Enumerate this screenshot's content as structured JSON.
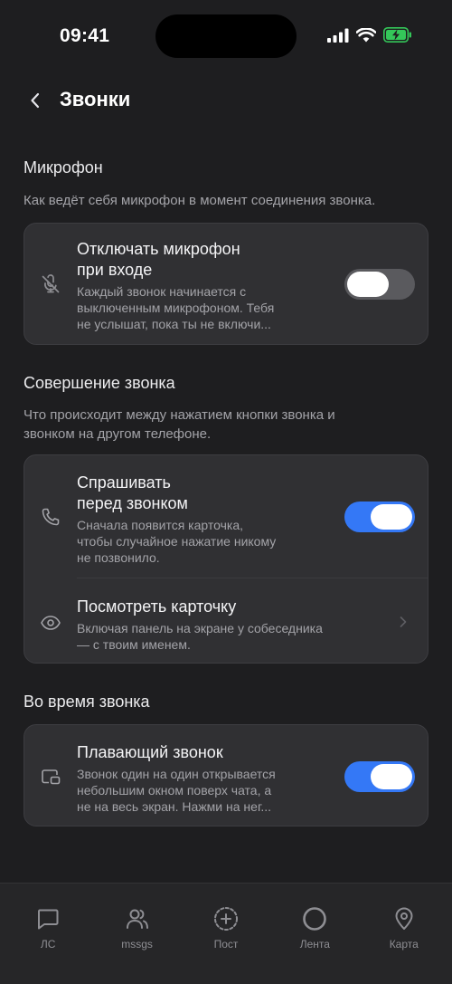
{
  "status": {
    "time": "09:41"
  },
  "header": {
    "title": "Звонки"
  },
  "sections": {
    "microphone": {
      "title": "Микрофон",
      "description": "Как ведёт себя микрофон в момент соединения звонка.",
      "row": {
        "title_line1": "Отключать микрофон",
        "title_line2": "при входе",
        "sub_line1": "Каждый звонок начинается с",
        "sub_line2": "выключенным микрофоном. Тебя",
        "sub_line3": "не услышат, пока ты не включи...",
        "toggle": "off",
        "icon": "mic-off-icon"
      }
    },
    "calling": {
      "title": "Совершение звонка",
      "description_line1": "Что происходит между нажатием кнопки звонка и",
      "description_line2": "звонком на другом телефоне.",
      "ask_row": {
        "title_line1": "Спрашивать",
        "title_line2": "перед звонком",
        "sub_line1": "Сначала появится карточка,",
        "sub_line2": "чтобы случайное нажатие никому",
        "sub_line3": "не позвонило.",
        "toggle": "on",
        "icon": "phone-icon"
      },
      "view_row": {
        "title": "Посмотреть карточку",
        "sub_line1": "Включая панель на экране у собеседника",
        "sub_line2": "— с твоим именем.",
        "icon": "eye-icon"
      }
    },
    "during": {
      "title": "Во время звонка",
      "row": {
        "title": "Плавающий звонок",
        "sub_line1": "Звонок один на один открывается",
        "sub_line2": "небольшим окном поверх чата, а",
        "sub_line3": "не на весь экран. Нажми на нег...",
        "toggle": "on",
        "icon": "picture-in-picture-icon"
      }
    }
  },
  "tabs": [
    {
      "label": "ЛС",
      "icon": "chat-bubble-icon"
    },
    {
      "label": "mssgs",
      "icon": "users-icon"
    },
    {
      "label": "Пост",
      "icon": "plus-circle-icon"
    },
    {
      "label": "Лента",
      "icon": "circle-icon"
    },
    {
      "label": "Карта",
      "icon": "map-pin-icon"
    }
  ],
  "colors": {
    "background": "#1e1e20",
    "card": "#303033",
    "accent": "#3478f6",
    "battery": "#34c759"
  }
}
